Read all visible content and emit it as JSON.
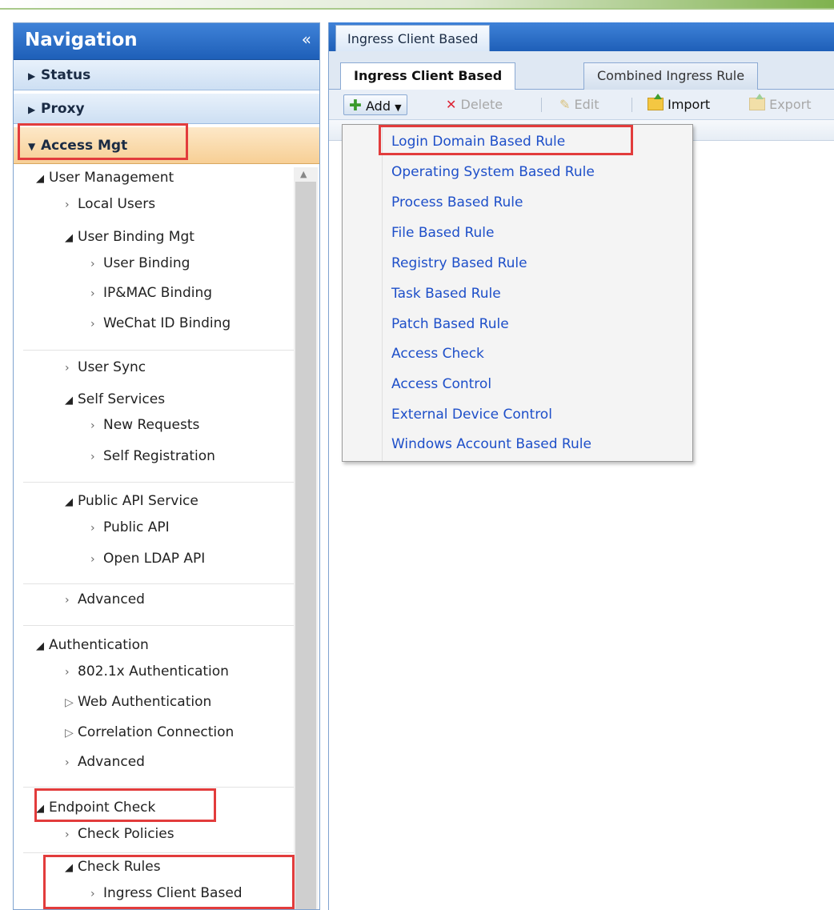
{
  "navigation": {
    "title": "Navigation",
    "collapse_icon": "«",
    "sections": [
      {
        "label": "Status"
      },
      {
        "label": "Proxy"
      },
      {
        "label": "Access Mgt"
      }
    ],
    "tree": {
      "user_management": "User Management",
      "local_users": "Local Users",
      "user_binding_mgt": "User Binding Mgt",
      "user_binding": "User Binding",
      "ip_mac_binding": "IP&MAC Binding",
      "wechat_binding": "WeChat ID Binding",
      "user_sync": "User Sync",
      "self_services": "Self Services",
      "new_requests": "New Requests",
      "self_registration": "Self Registration",
      "public_api_service": "Public API Service",
      "public_api": "Public API",
      "open_ldap_api": "Open LDAP API",
      "advanced_1": "Advanced",
      "authentication": "Authentication",
      "auth_8021x": "802.1x Authentication",
      "web_auth": "Web Authentication",
      "correlation": "Correlation Connection",
      "advanced_2": "Advanced",
      "endpoint_check": "Endpoint Check",
      "check_policies": "Check Policies",
      "check_rules": "Check Rules",
      "ingress_client_based": "Ingress Client Based"
    }
  },
  "main": {
    "outer_tab": "Ingress Client Based",
    "inner_tabs": [
      "Ingress Client Based",
      "Combined Ingress Rule"
    ],
    "toolbar": {
      "add": "Add",
      "delete": "Delete",
      "edit": "Edit",
      "import": "Import",
      "export": "Export"
    }
  },
  "add_menu": {
    "items": [
      "Login Domain Based Rule",
      "Operating System Based Rule",
      "Process Based Rule",
      "File Based Rule",
      "Registry Based Rule",
      "Task Based Rule",
      "Patch Based Rule",
      "Access Check",
      "Access Control",
      "External Device Control",
      "Windows Account Based Rule"
    ]
  },
  "colors": {
    "nav_header": "#1e5fb8",
    "active_section": "#f7cf95",
    "menu_link": "#1e4fc9",
    "highlight": "#e23c3c"
  },
  "icons": {
    "collapse": "double-chevron-left-icon",
    "add": "plus-icon",
    "delete": "x-icon",
    "edit": "pencil-icon",
    "import": "import-folder-icon",
    "export": "export-folder-icon"
  }
}
